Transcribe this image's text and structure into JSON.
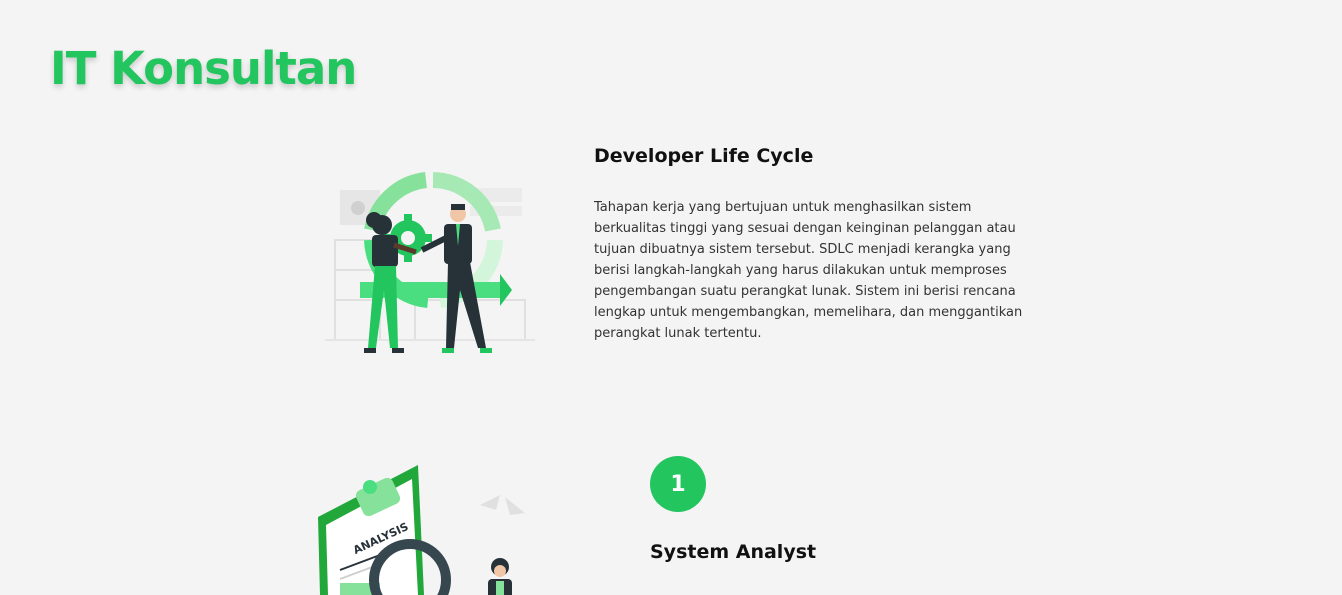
{
  "page": {
    "title": "IT Konsultan"
  },
  "sdlc": {
    "heading": "Developer Life Cycle",
    "description": "Tahapan kerja yang bertujuan untuk menghasilkan sistem berkualitas tinggi yang sesuai dengan keinginan pelanggan atau tujuan dibuatnya sistem tersebut. SDLC menjadi kerangka yang berisi langkah-langkah yang harus dilakukan untuk memproses pengembangan suatu perangkat lunak. Sistem ini berisi rencana lengkap untuk mengembangkan, memelihara, dan menggantikan perangkat lunak tertentu."
  },
  "steps": [
    {
      "number": "1",
      "title": "System Analyst",
      "illustration_label": "ANALYSIS"
    }
  ],
  "colors": {
    "accent": "#22c55e",
    "background": "#f4f4f4"
  }
}
